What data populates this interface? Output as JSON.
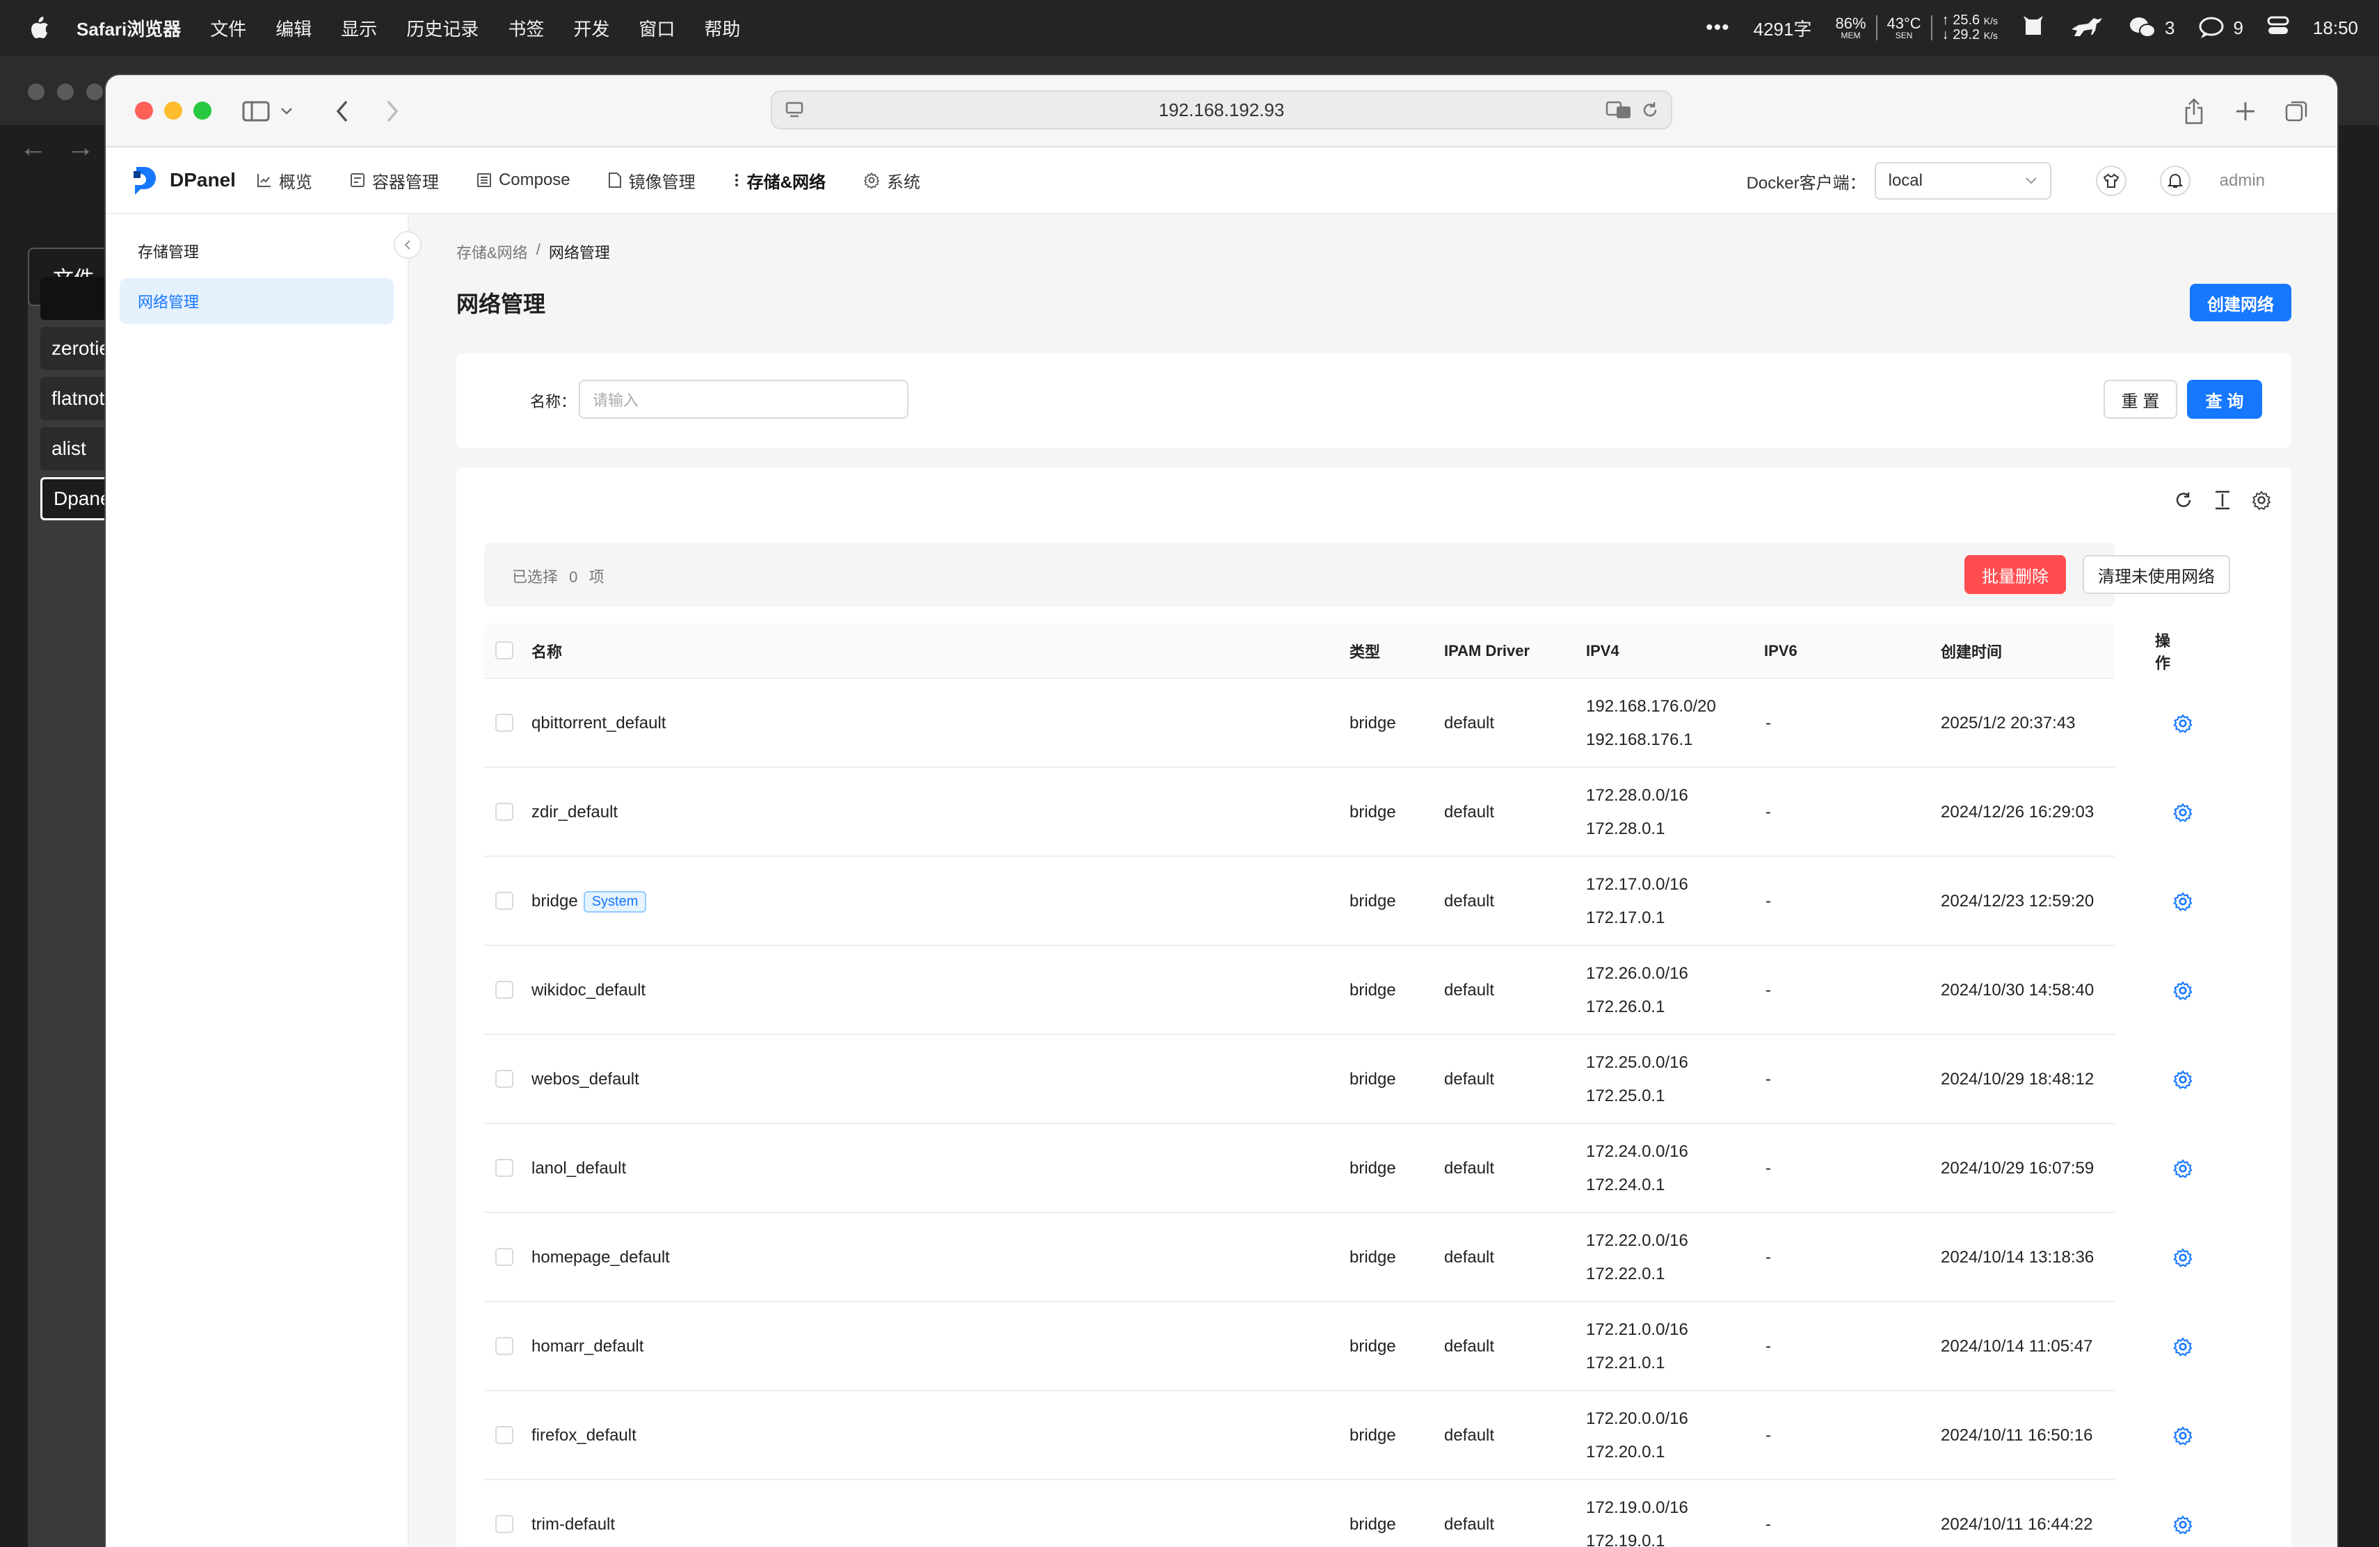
{
  "menubar": {
    "app": "Safari浏览器",
    "items": [
      "文件",
      "编辑",
      "显示",
      "历史记录",
      "书签",
      "开发",
      "窗口",
      "帮助"
    ],
    "status": {
      "words": "4291字",
      "mem": "86%",
      "mem_label": "MEM",
      "temp": "43°C",
      "temp_label": "SEN",
      "net_up": "25.6",
      "net_down": "29.2",
      "net_unit": "K/s",
      "wechat_count": "3",
      "msg_count": "9",
      "time": "18:50"
    }
  },
  "background_app": {
    "file_label": "文件",
    "items": [
      "zerotie",
      "flatnot",
      "alist",
      "Dpane"
    ]
  },
  "browser": {
    "url": "192.168.192.93"
  },
  "app": {
    "brand": "DPanel",
    "nav": [
      {
        "label": "概览",
        "icon": "chart-icon"
      },
      {
        "label": "容器管理",
        "icon": "container-icon"
      },
      {
        "label": "Compose",
        "icon": "compose-icon"
      },
      {
        "label": "镜像管理",
        "icon": "image-file-icon"
      },
      {
        "label": "存储&网络",
        "icon": "more-vertical-icon"
      },
      {
        "label": "系统",
        "icon": "gear-icon"
      }
    ],
    "docker_label": "Docker客户端：",
    "docker_value": "local",
    "user": "admin",
    "accent": "#1677ff",
    "danger": "#ff4d4f"
  },
  "side": {
    "items": [
      "存储管理",
      "网络管理"
    ],
    "active_index": 1
  },
  "page": {
    "breadcrumb": [
      "存储&网络",
      "网络管理"
    ],
    "breadcrumb_sep": "/",
    "title": "网络管理",
    "create_button": "创建网络",
    "search": {
      "label": "名称：",
      "placeholder": "请输入",
      "reset": "重 置",
      "query": "查 询"
    },
    "selection": {
      "text_before": "已选择",
      "count": "0",
      "text_after": "项",
      "batch_delete": "批量删除",
      "prune": "清理未使用网络"
    },
    "table": {
      "columns": [
        "名称",
        "类型",
        "IPAM Driver",
        "IPV4",
        "IPV6",
        "创建时间",
        "操作"
      ],
      "rows": [
        {
          "name": "qbittorrent_default",
          "tag": "",
          "type": "bridge",
          "ipam": "default",
          "subnet": "192.168.176.0/20",
          "gateway": "192.168.176.1",
          "ipv6": "-",
          "created": "2025/1/2 20:37:43"
        },
        {
          "name": "zdir_default",
          "tag": "",
          "type": "bridge",
          "ipam": "default",
          "subnet": "172.28.0.0/16",
          "gateway": "172.28.0.1",
          "ipv6": "-",
          "created": "2024/12/26 16:29:03"
        },
        {
          "name": "bridge",
          "tag": "System",
          "type": "bridge",
          "ipam": "default",
          "subnet": "172.17.0.0/16",
          "gateway": "172.17.0.1",
          "ipv6": "-",
          "created": "2024/12/23 12:59:20"
        },
        {
          "name": "wikidoc_default",
          "tag": "",
          "type": "bridge",
          "ipam": "default",
          "subnet": "172.26.0.0/16",
          "gateway": "172.26.0.1",
          "ipv6": "-",
          "created": "2024/10/30 14:58:40"
        },
        {
          "name": "webos_default",
          "tag": "",
          "type": "bridge",
          "ipam": "default",
          "subnet": "172.25.0.0/16",
          "gateway": "172.25.0.1",
          "ipv6": "-",
          "created": "2024/10/29 18:48:12"
        },
        {
          "name": "lanol_default",
          "tag": "",
          "type": "bridge",
          "ipam": "default",
          "subnet": "172.24.0.0/16",
          "gateway": "172.24.0.1",
          "ipv6": "-",
          "created": "2024/10/29 16:07:59"
        },
        {
          "name": "homepage_default",
          "tag": "",
          "type": "bridge",
          "ipam": "default",
          "subnet": "172.22.0.0/16",
          "gateway": "172.22.0.1",
          "ipv6": "-",
          "created": "2024/10/14 13:18:36"
        },
        {
          "name": "homarr_default",
          "tag": "",
          "type": "bridge",
          "ipam": "default",
          "subnet": "172.21.0.0/16",
          "gateway": "172.21.0.1",
          "ipv6": "-",
          "created": "2024/10/14 11:05:47"
        },
        {
          "name": "firefox_default",
          "tag": "",
          "type": "bridge",
          "ipam": "default",
          "subnet": "172.20.0.0/16",
          "gateway": "172.20.0.1",
          "ipv6": "-",
          "created": "2024/10/11 16:50:16"
        },
        {
          "name": "trim-default",
          "tag": "",
          "type": "bridge",
          "ipam": "default",
          "subnet": "172.19.0.0/16",
          "gateway": "172.19.0.1",
          "ipv6": "-",
          "created": "2024/10/11 16:44:22"
        }
      ]
    }
  }
}
